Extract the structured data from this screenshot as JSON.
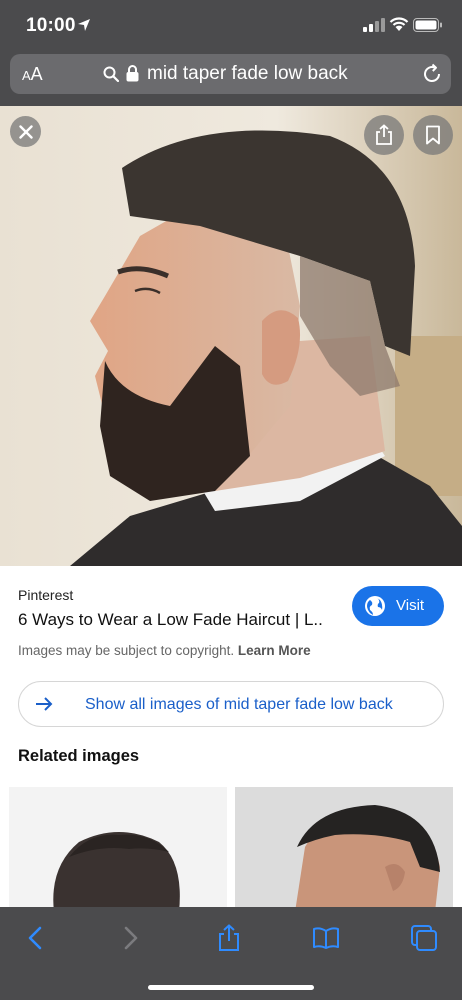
{
  "status_bar": {
    "time": "10:00"
  },
  "address_bar": {
    "text_size_label": "AA",
    "url_text": "mid taper fade low back"
  },
  "image_viewer": {
    "icons": [
      "close-icon",
      "share-icon",
      "bookmark-icon"
    ]
  },
  "result": {
    "source": "Pinterest",
    "title": "6 Ways to Wear a Low Fade Haircut | L...",
    "visit_label": "Visit",
    "copyright_text": "Images may be subject to copyright.",
    "learn_more": "Learn More",
    "show_all_label": "Show all images of mid taper fade low back"
  },
  "related": {
    "heading": "Related images"
  },
  "toolbar": {
    "icons": [
      "back-icon",
      "forward-icon",
      "share-icon",
      "bookmarks-icon",
      "tabs-icon"
    ]
  },
  "colors": {
    "chrome": "#4b4b4d",
    "accent": "#1a73e8",
    "link": "#1a5fc9"
  }
}
